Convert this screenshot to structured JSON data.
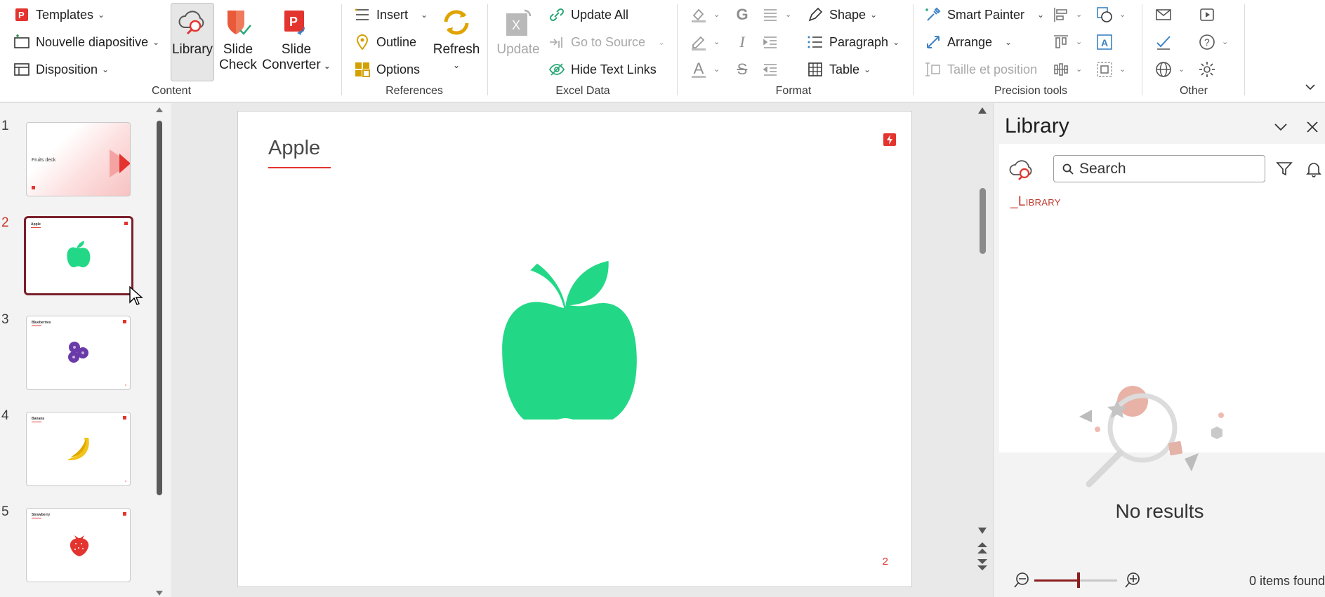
{
  "ribbon": {
    "content": {
      "templates": "Templates",
      "new_slide": "Nouvelle diapositive",
      "layout": "Disposition",
      "library": "Library",
      "slide_check_1": "Slide",
      "slide_check_2": "Check",
      "slide_converter_1": "Slide",
      "slide_converter_2": "Converter",
      "label": "Content"
    },
    "references": {
      "insert": "Insert",
      "outline": "Outline",
      "options": "Options",
      "refresh": "Refresh",
      "label": "References"
    },
    "excel": {
      "update": "Update",
      "update_all": "Update All",
      "go_to_source": "Go to Source",
      "hide_text_links": "Hide Text Links",
      "label": "Excel Data"
    },
    "format": {
      "bold": "G",
      "italic": "I",
      "strike": "S",
      "font_color": "A",
      "shape": "Shape",
      "paragraph": "Paragraph",
      "table": "Table",
      "label": "Format"
    },
    "precision": {
      "smart_painter": "Smart Painter",
      "arrange": "Arrange",
      "size_position": "Taille et position",
      "label": "Precision tools"
    },
    "other": {
      "label": "Other"
    }
  },
  "slides": [
    {
      "number": "1",
      "title": "Fruits deck"
    },
    {
      "number": "2",
      "title": "Apple"
    },
    {
      "number": "3",
      "title": "Blueberries"
    },
    {
      "number": "4",
      "title": "Banana"
    },
    {
      "number": "5",
      "title": "Strawberry"
    }
  ],
  "current_slide": {
    "title": "Apple",
    "page_number": "2"
  },
  "library": {
    "title": "Library",
    "search_placeholder": "Search",
    "root": "_Library",
    "no_results": "No results",
    "items_found": "0 items found"
  },
  "colors": {
    "accent": "#e3342f",
    "selection": "#7a1f2b",
    "apple_green": "#22d886"
  }
}
